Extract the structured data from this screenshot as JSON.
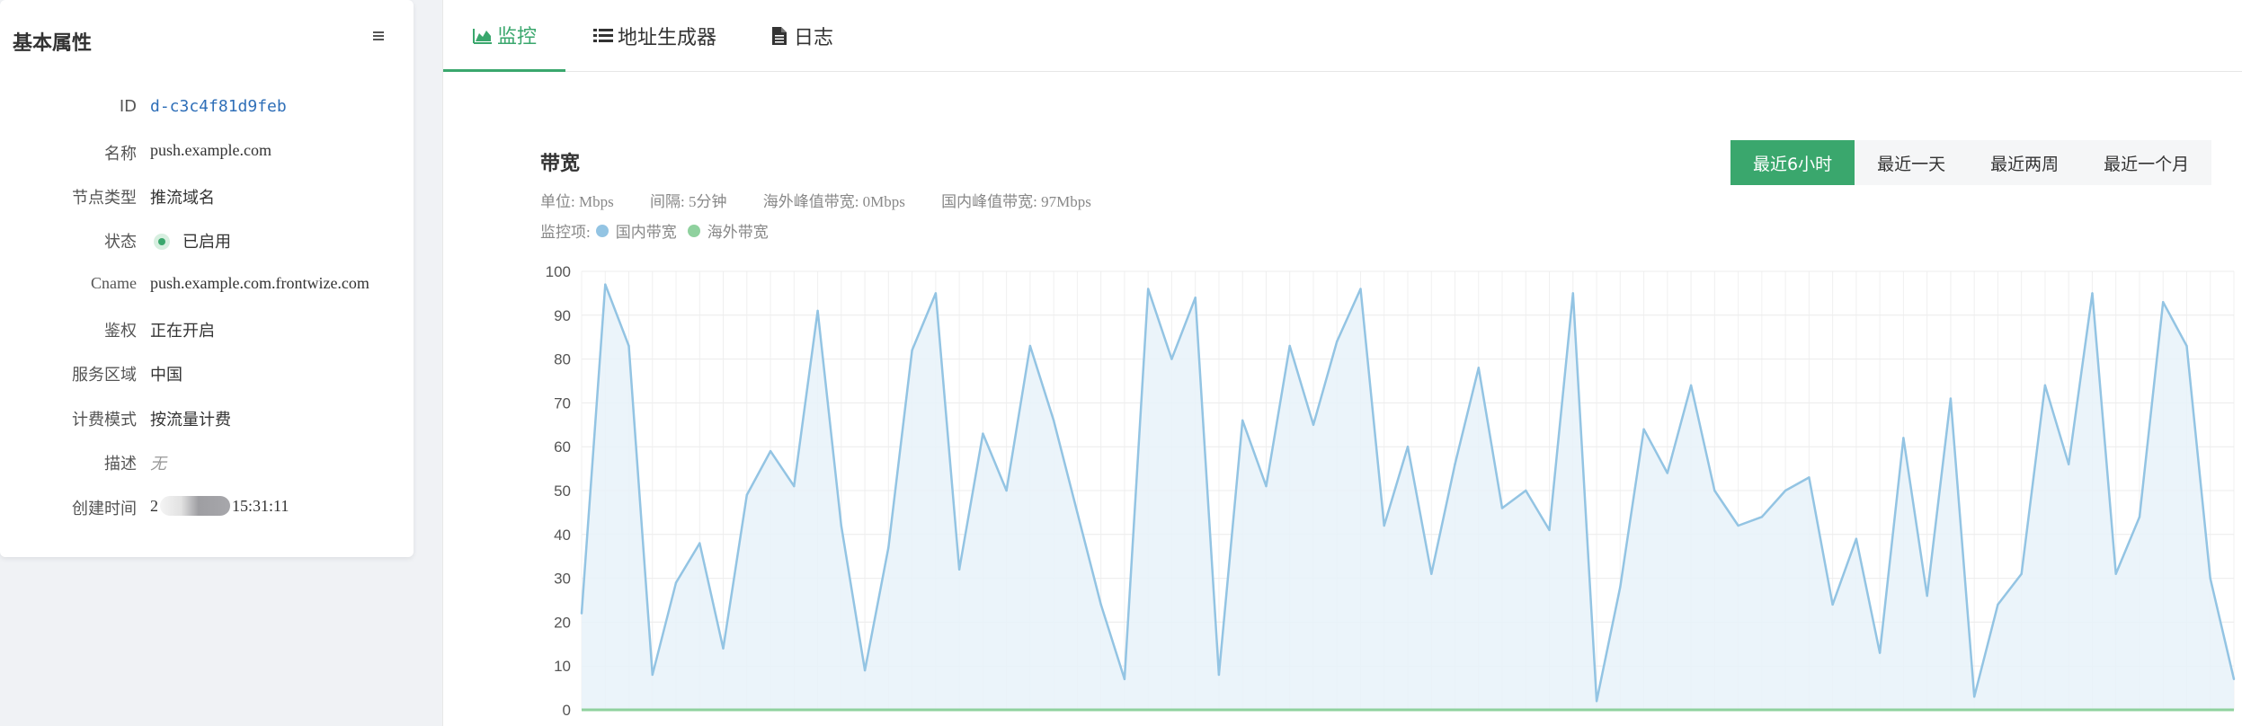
{
  "properties_panel": {
    "title": "基本属性",
    "rows": [
      {
        "label": "ID",
        "value": "d-c3c4f81d9feb"
      },
      {
        "label": "名称",
        "value": "push.example.com"
      },
      {
        "label": "节点类型",
        "value": "推流域名"
      },
      {
        "label": "状态",
        "value": "已启用"
      },
      {
        "label": "Cname",
        "value": "push.example.com.frontwize.com"
      },
      {
        "label": "鉴权",
        "value": "正在开启"
      },
      {
        "label": "服务区域",
        "value": "中国"
      },
      {
        "label": "计费模式",
        "value": "按流量计费"
      },
      {
        "label": "描述",
        "value": "无"
      },
      {
        "label": "创建时间",
        "value_prefix": "2",
        "value_suffix": "15:31:11"
      }
    ]
  },
  "tabs": [
    {
      "label": "监控",
      "icon": "area-chart-icon",
      "active": true
    },
    {
      "label": "地址生成器",
      "icon": "list-icon",
      "active": false
    },
    {
      "label": "日志",
      "icon": "file-icon",
      "active": false
    }
  ],
  "bandwidth": {
    "title": "带宽",
    "unit": "单位: Mbps",
    "interval": "间隔: 5分钟",
    "overseas_peak": "海外峰值带宽: 0Mbps",
    "domestic_peak": "国内峰值带宽: 97Mbps",
    "legend_prefix": "监控项:",
    "range_buttons": [
      {
        "label": "最近6小时",
        "active": true
      },
      {
        "label": "最近一天",
        "active": false
      },
      {
        "label": "最近两周",
        "active": false
      },
      {
        "label": "最近一个月",
        "active": false
      }
    ]
  },
  "colors": {
    "accent": "#3aa76d",
    "domestic_line": "#93c4e3",
    "overseas_line": "#8fd19e"
  },
  "chart_data": {
    "type": "area",
    "ylim": [
      0,
      100
    ],
    "y_ticks": [
      0,
      10,
      20,
      30,
      40,
      50,
      60,
      70,
      80,
      90,
      100
    ],
    "legend_position": "top-left",
    "grid": true,
    "series": [
      {
        "name": "国内带宽",
        "color": "#93c4e3",
        "values": [
          22,
          97,
          83,
          8,
          29,
          38,
          14,
          49,
          59,
          51,
          91,
          42,
          9,
          37,
          82,
          95,
          32,
          63,
          50,
          83,
          66,
          45,
          24,
          7,
          96,
          80,
          94,
          8,
          66,
          51,
          83,
          65,
          84,
          96,
          42,
          60,
          31,
          56,
          78,
          46,
          50,
          41,
          95,
          2,
          28,
          64,
          54,
          74,
          50,
          42,
          44,
          50,
          53,
          24,
          39,
          13,
          62,
          26,
          71,
          3,
          24,
          31,
          74,
          56,
          95,
          31,
          44,
          93,
          83,
          30,
          7
        ]
      },
      {
        "name": "海外带宽",
        "color": "#8fd19e",
        "values": [
          0,
          0,
          0,
          0,
          0,
          0,
          0,
          0,
          0,
          0,
          0,
          0,
          0,
          0,
          0,
          0,
          0,
          0,
          0,
          0,
          0,
          0,
          0,
          0,
          0,
          0,
          0,
          0,
          0,
          0,
          0,
          0,
          0,
          0,
          0,
          0,
          0,
          0,
          0,
          0,
          0,
          0,
          0,
          0,
          0,
          0,
          0,
          0,
          0,
          0,
          0,
          0,
          0,
          0,
          0,
          0,
          0,
          0,
          0,
          0,
          0,
          0,
          0,
          0,
          0,
          0,
          0,
          0,
          0,
          0,
          0
        ]
      }
    ]
  }
}
